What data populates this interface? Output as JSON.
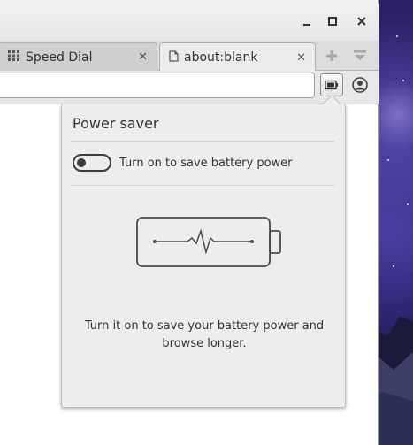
{
  "browser": {
    "tabs": [
      {
        "label": "Speed Dial",
        "icon": "speed-dial-grid-icon",
        "active": false
      },
      {
        "label": "about:blank",
        "icon": "page-icon",
        "active": true
      }
    ],
    "window_controls": [
      "minimize",
      "maximize",
      "close"
    ],
    "url": ""
  },
  "power_saver": {
    "title": "Power saver",
    "toggle_label": "Turn on to save battery power",
    "toggle_on": false,
    "description": "Turn it on to save your battery power and browse longer."
  },
  "colors": {
    "popup_bg": "#ededed",
    "text": "#2e3436",
    "toggle": "#3d3d3d"
  }
}
